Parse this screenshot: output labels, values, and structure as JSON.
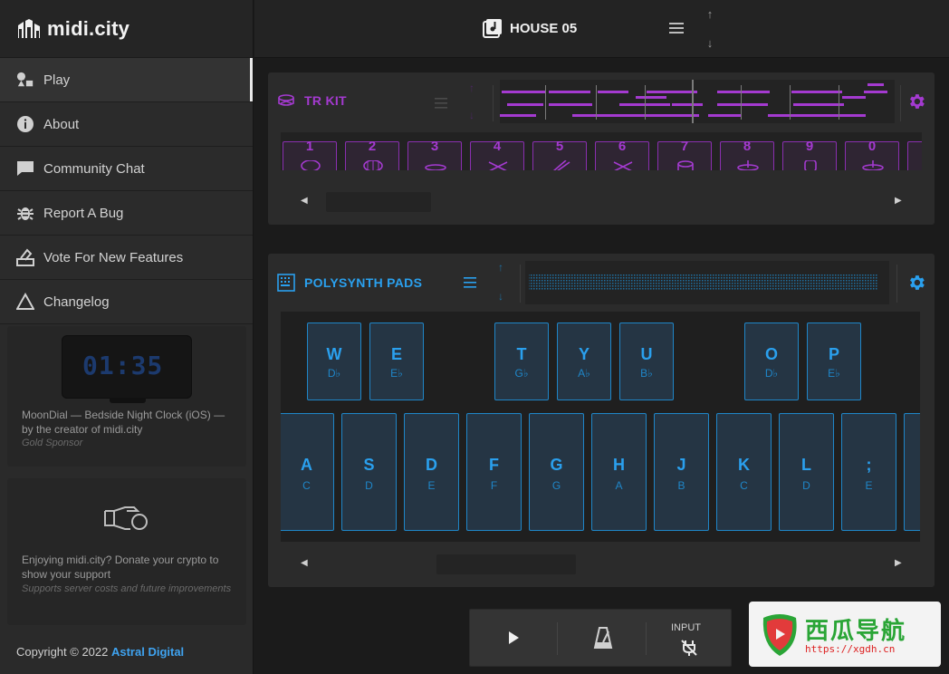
{
  "brand": {
    "name": "midi.city"
  },
  "nav": [
    {
      "label": "Play",
      "icon": "shapes-icon"
    },
    {
      "label": "About",
      "icon": "info-icon"
    },
    {
      "label": "Community Chat",
      "icon": "chat-icon"
    },
    {
      "label": "Report A Bug",
      "icon": "bug-icon"
    },
    {
      "label": "Vote For New Features",
      "icon": "ballot-icon"
    },
    {
      "label": "Changelog",
      "icon": "triangle-icon"
    }
  ],
  "sponsor": {
    "clock_time": "01:35",
    "text": "MoonDial — Bedside Night Clock (iOS) — by the creator of midi.city",
    "tier": "Gold Sponsor"
  },
  "donate": {
    "text": "Enjoying midi.city? Donate your crypto to show your support",
    "sub": "Supports server costs and future improvements"
  },
  "footer": {
    "copyright": "Copyright © 2022 ",
    "company": "Astral Digital"
  },
  "topbar": {
    "song_title": "HOUSE 05"
  },
  "tr_kit": {
    "title": "TR  KIT",
    "pads": [
      "1",
      "2",
      "3",
      "4",
      "5",
      "6",
      "7",
      "8",
      "9",
      "0"
    ]
  },
  "polysynth": {
    "title": "POLYSYNTH PADS",
    "black_keys": [
      {
        "key": "W",
        "note": "D♭"
      },
      {
        "key": "E",
        "note": "E♭"
      },
      {
        "key": "T",
        "note": "G♭"
      },
      {
        "key": "Y",
        "note": "A♭"
      },
      {
        "key": "U",
        "note": "B♭"
      },
      {
        "key": "O",
        "note": "D♭"
      },
      {
        "key": "P",
        "note": "E♭"
      }
    ],
    "white_keys": [
      {
        "key": "A",
        "note": "C"
      },
      {
        "key": "S",
        "note": "D"
      },
      {
        "key": "D",
        "note": "E"
      },
      {
        "key": "F",
        "note": "F"
      },
      {
        "key": "G",
        "note": "G"
      },
      {
        "key": "H",
        "note": "A"
      },
      {
        "key": "J",
        "note": "B"
      },
      {
        "key": "K",
        "note": "C"
      },
      {
        "key": "L",
        "note": "D"
      },
      {
        "key": ";",
        "note": "E"
      }
    ]
  },
  "transport": {
    "input_label": "INPUT"
  },
  "watermark": {
    "title": "西瓜导航",
    "url": "https://xgdh.cn"
  },
  "colors": {
    "tr_accent": "#a43ad0",
    "poly_accent": "#2aa0ee",
    "link": "#3fa3f0"
  }
}
